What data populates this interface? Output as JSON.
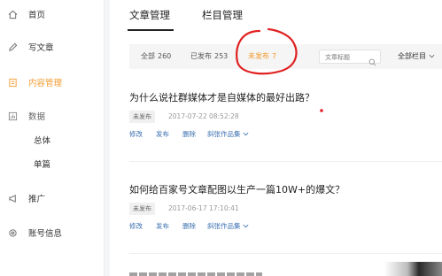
{
  "sidebar": {
    "items": [
      {
        "label": "首页",
        "icon": "home-icon"
      },
      {
        "label": "写文章",
        "icon": "pencil-icon"
      },
      {
        "label": "内容管理",
        "icon": "document-icon",
        "active": true
      },
      {
        "label": "数据",
        "icon": "chart-icon"
      },
      {
        "label": "总体"
      },
      {
        "label": "单篇"
      },
      {
        "label": "推广",
        "icon": "megaphone-icon"
      },
      {
        "label": "账号信息",
        "icon": "gear-icon"
      }
    ]
  },
  "tabs": [
    "文章管理",
    "栏目管理"
  ],
  "filters": [
    {
      "label": "全部",
      "count": "260"
    },
    {
      "label": "已发布",
      "count": "253"
    },
    {
      "label": "未发布",
      "count": "7",
      "active": true
    }
  ],
  "search": {
    "placeholder": "文章标题"
  },
  "category_select": "全部栏目",
  "articles": [
    {
      "title": "为什么说社群媒体才是自媒体的最好出路？",
      "status": "未发布",
      "date": "2017-07-22 08:52:28",
      "actions": [
        "修改",
        "发布",
        "删除",
        "斜张作品集"
      ]
    },
    {
      "title": "如何给百家号文章配图以生产一篇10W+的爆文？",
      "status": "未发布",
      "date": "2017-06-17 17:10:41",
      "actions": [
        "修改",
        "发布",
        "删除",
        "斜张作品集"
      ]
    }
  ],
  "colors": {
    "accent": "#f29b2f",
    "link": "#3a6fb0",
    "annotation": "#e02020"
  }
}
